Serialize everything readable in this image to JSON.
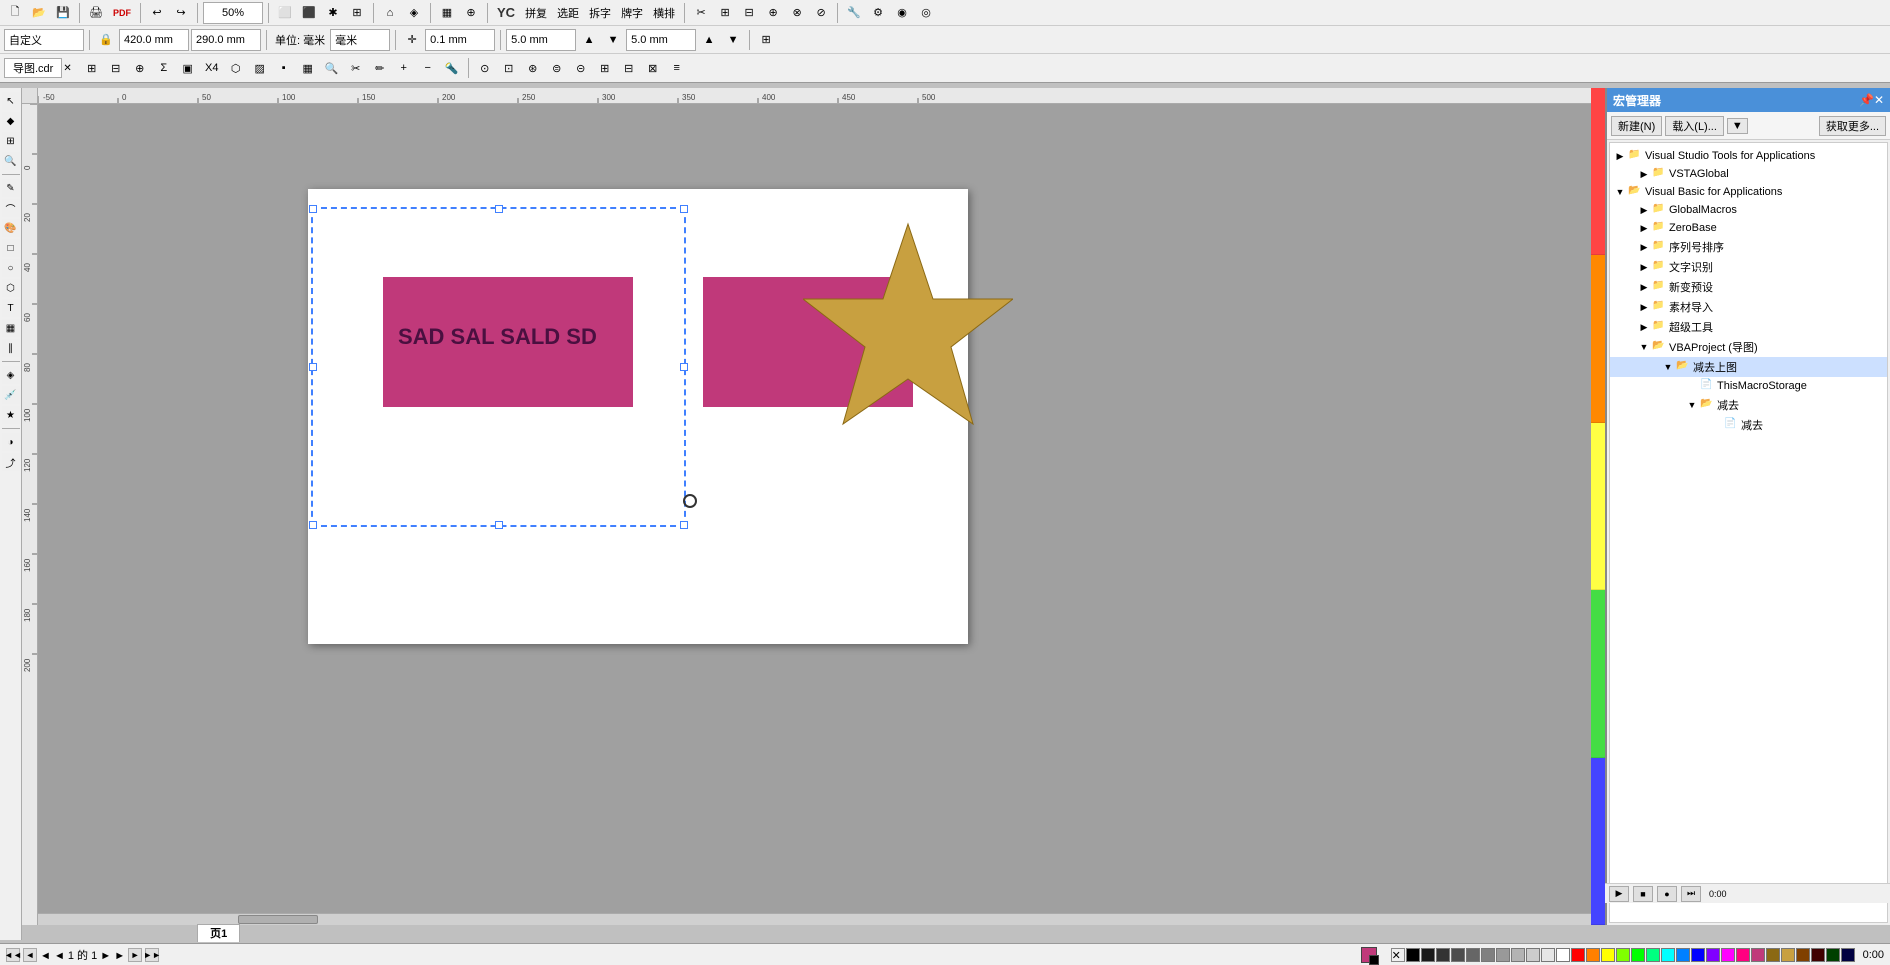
{
  "app": {
    "title": "宏管理器",
    "file_tab": "导图.cdr",
    "zoom": "50%"
  },
  "toolbar1": {
    "buttons": [
      "new",
      "open",
      "save",
      "print",
      "pdf",
      "undo",
      "redo"
    ],
    "zoom_value": "50%"
  },
  "toolbar2": {
    "position_label": "自定义",
    "width": "420.0 mm",
    "height": "290.0 mm",
    "unit_label": "单位: 毫米",
    "step": "0.1 mm",
    "nudge1": "5.0 mm",
    "nudge2": "5.0 mm"
  },
  "toolbar3": {
    "buttons": []
  },
  "canvas": {
    "object_text": "SAD SAL SALD SD",
    "page_label": "页1"
  },
  "macro_panel": {
    "title": "宏管理器",
    "btn_new": "新建(N)",
    "btn_load": "载入(L)...",
    "btn_options": "▼",
    "btn_get_more": "获取更多...",
    "tree": [
      {
        "id": "vsta",
        "label": "Visual Studio Tools for Applications",
        "icon": "folder",
        "expanded": true,
        "children": [
          {
            "id": "vstaglobal",
            "label": "VSTAGlobal",
            "icon": "folder",
            "expanded": false,
            "children": []
          }
        ]
      },
      {
        "id": "vba",
        "label": "Visual Basic for Applications",
        "icon": "folder",
        "expanded": true,
        "children": [
          {
            "id": "globalmacros",
            "label": "GlobalMacros",
            "icon": "folder",
            "expanded": false,
            "children": []
          },
          {
            "id": "zerobase",
            "label": "ZeroBase",
            "icon": "folder",
            "expanded": false,
            "children": []
          },
          {
            "id": "seqnum",
            "label": "序列号排序",
            "icon": "folder",
            "expanded": false,
            "children": []
          },
          {
            "id": "textrecog",
            "label": "文字识别",
            "icon": "folder",
            "expanded": false,
            "children": []
          },
          {
            "id": "newvar",
            "label": "新变预设",
            "icon": "folder",
            "expanded": false,
            "children": []
          },
          {
            "id": "matimport",
            "label": "素材导入",
            "icon": "folder",
            "expanded": false,
            "children": []
          },
          {
            "id": "supertool",
            "label": "超级工具",
            "icon": "folder",
            "expanded": false,
            "children": []
          },
          {
            "id": "vbaproject",
            "label": "VBAProject (导图)",
            "icon": "folder",
            "expanded": true,
            "children": [
              {
                "id": "jianqu",
                "label": "减去上图",
                "icon": "folder",
                "expanded": true,
                "children": [
                  {
                    "id": "thismacro",
                    "label": "ThisMacroStorage",
                    "icon": "doc",
                    "expanded": false,
                    "children": []
                  },
                  {
                    "id": "jianqu2",
                    "label": "减去",
                    "icon": "folder",
                    "expanded": true,
                    "children": [
                      {
                        "id": "jianqu3",
                        "label": "减去",
                        "icon": "doc",
                        "expanded": false,
                        "children": []
                      }
                    ]
                  }
                ]
              }
            ]
          }
        ]
      }
    ]
  },
  "status_bar": {
    "page_info": "◄ ◄ 1 的 1 ► ►",
    "page_label": "页1",
    "time": "0:00"
  },
  "colors": {
    "current_fill": "#c0397a",
    "current_stroke": "#000000",
    "swatches": [
      "#000000",
      "#4a4a4a",
      "#ffffff",
      "#ff0000",
      "#ff8800",
      "#ffff00",
      "#00aa00",
      "#0000ff",
      "#8800ff",
      "#ff00ff",
      "#c0397a",
      "#8B6914"
    ]
  }
}
